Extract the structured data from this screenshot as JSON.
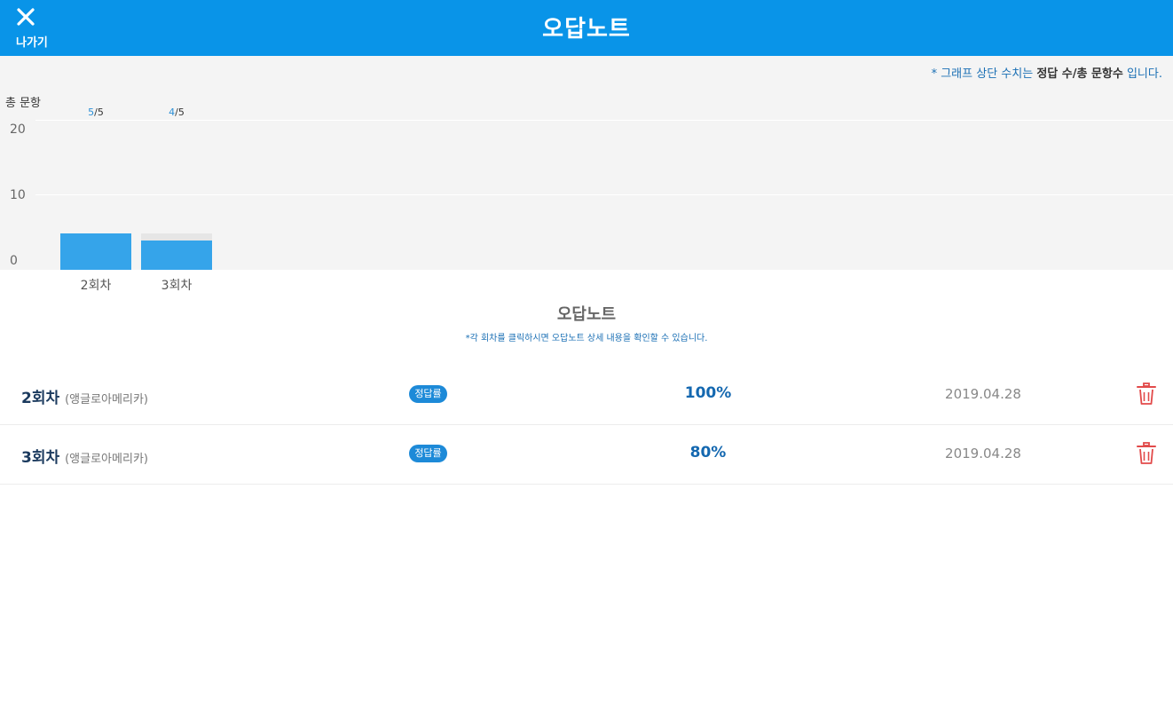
{
  "header": {
    "exit_label": "나가기",
    "title": "오답노트",
    "color": "#0994e8"
  },
  "chart_note": {
    "prefix": "* 그래프 상단 수치는 ",
    "bold1": "정답 수",
    "sep": "/",
    "bold2": "총 문항수",
    "suffix": " 입니다."
  },
  "chart_data": {
    "type": "bar",
    "ylabel": "총 문항",
    "yticks": [
      "20",
      "10",
      "0"
    ],
    "ylim": [
      0,
      20
    ],
    "categories": [
      "2회차",
      "3회차"
    ],
    "series": [
      {
        "name": "정답 수",
        "values": [
          5,
          4
        ]
      },
      {
        "name": "총 문항수",
        "values": [
          5,
          5
        ]
      }
    ],
    "bar_labels": [
      {
        "correct": "5",
        "slash": "/",
        "total": "5"
      },
      {
        "correct": "4",
        "slash": "/",
        "total": "5"
      }
    ],
    "colors": {
      "correct": "#35a4ea",
      "total": "#e6e6e6"
    }
  },
  "section": {
    "title": "오답노트",
    "subtitle": "*각 회차를 클릭하시면 오답노트 상세 내용을 확인할 수 있습니다."
  },
  "records": [
    {
      "round": "2회차",
      "book": "(앵글로아메리카)",
      "badge": "정답률",
      "rate": "100%",
      "date": "2019.04.28"
    },
    {
      "round": "3회차",
      "book": "(앵글로아메리카)",
      "badge": "정답률",
      "rate": "80%",
      "date": "2019.04.28"
    }
  ],
  "icons": {
    "exit": "close-icon",
    "delete": "trash-icon",
    "trash_color": "#e24a4a"
  }
}
